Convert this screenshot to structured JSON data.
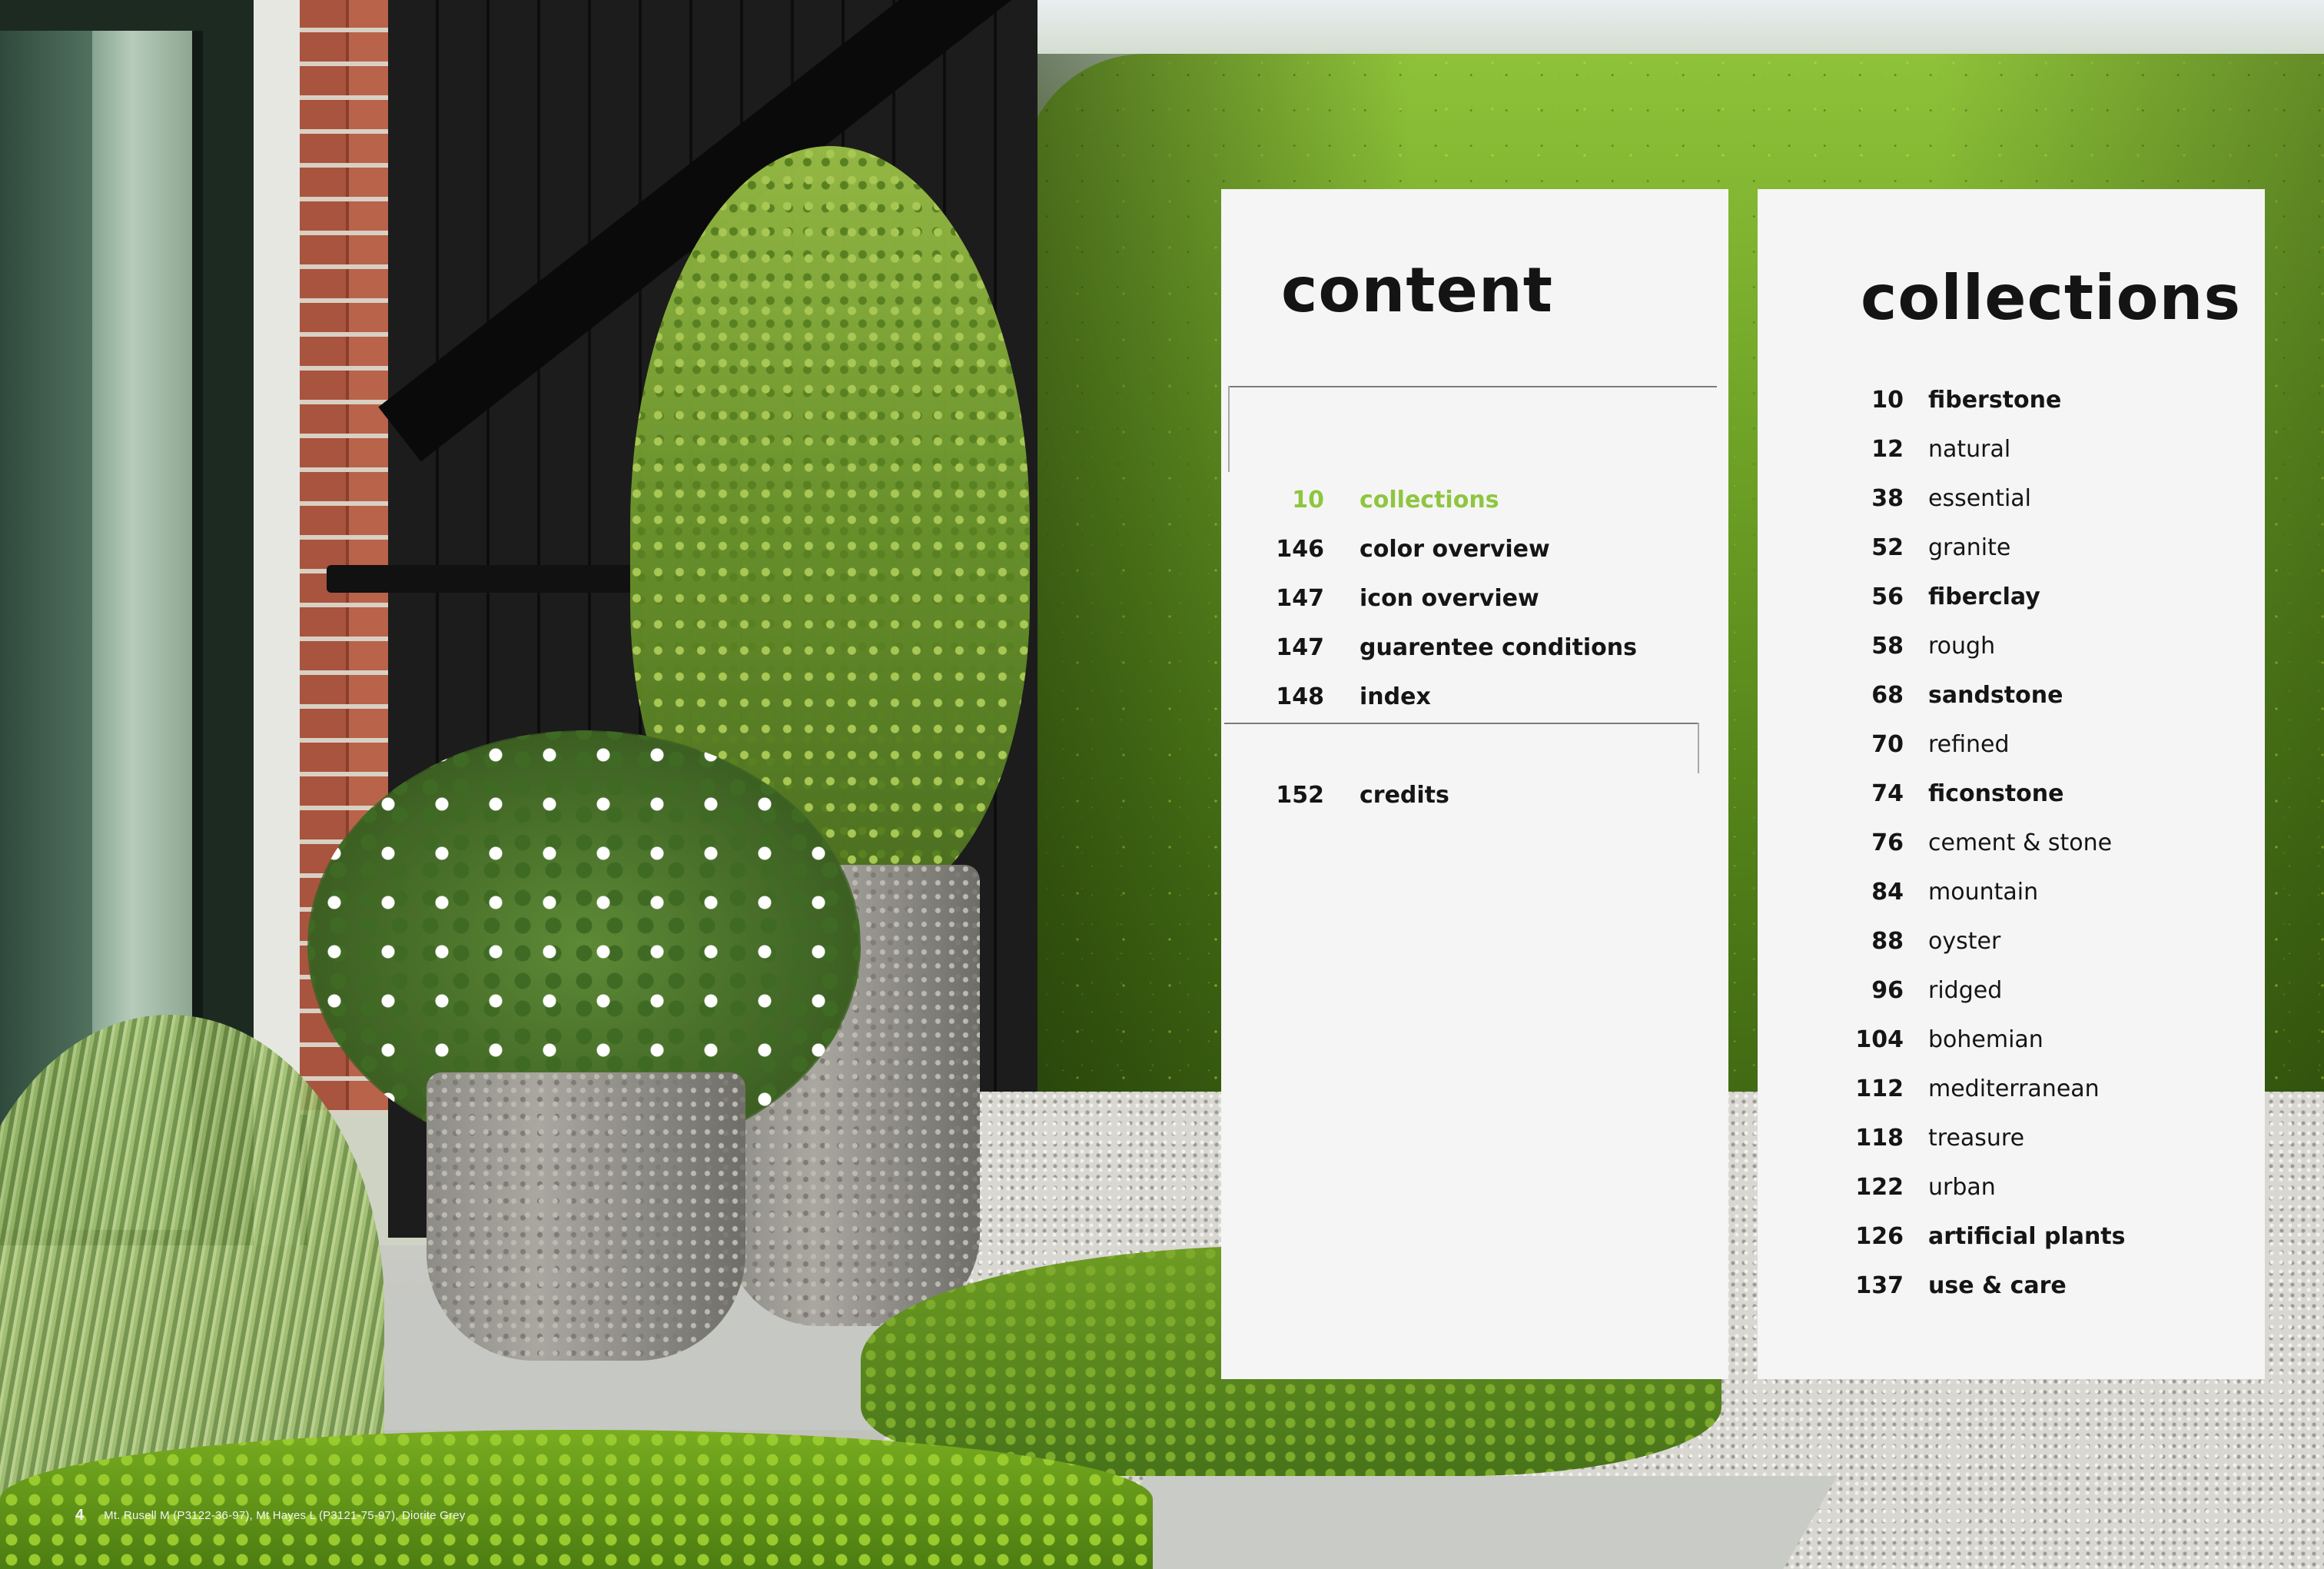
{
  "content_panel": {
    "title": "content",
    "items": [
      {
        "page": "10",
        "label": "collections",
        "highlight": true
      },
      {
        "page": "146",
        "label": "color overview",
        "highlight": false
      },
      {
        "page": "147",
        "label": "icon overview",
        "highlight": false
      },
      {
        "page": "147",
        "label": "guarentee conditions",
        "highlight": false
      },
      {
        "page": "148",
        "label": "index",
        "highlight": false
      },
      {
        "page": "152",
        "label": "credits",
        "highlight": false
      }
    ],
    "accent_color": "#8ec63f"
  },
  "collections_panel": {
    "title": "collections",
    "items": [
      {
        "page": "10",
        "label": "fiberstone",
        "bold": true
      },
      {
        "page": "12",
        "label": "natural",
        "bold": false
      },
      {
        "page": "38",
        "label": "essential",
        "bold": false
      },
      {
        "page": "52",
        "label": "granite",
        "bold": false
      },
      {
        "page": "56",
        "label": "fiberclay",
        "bold": true
      },
      {
        "page": "58",
        "label": "rough",
        "bold": false
      },
      {
        "page": "68",
        "label": "sandstone",
        "bold": true
      },
      {
        "page": "70",
        "label": "refined",
        "bold": false
      },
      {
        "page": "74",
        "label": "ficonstone",
        "bold": true
      },
      {
        "page": "76",
        "label": "cement & stone",
        "bold": false
      },
      {
        "page": "84",
        "label": "mountain",
        "bold": false
      },
      {
        "page": "88",
        "label": "oyster",
        "bold": false
      },
      {
        "page": "96",
        "label": "ridged",
        "bold": false
      },
      {
        "page": "104",
        "label": "bohemian",
        "bold": false
      },
      {
        "page": "112",
        "label": "mediterranean",
        "bold": false
      },
      {
        "page": "118",
        "label": "treasure",
        "bold": false
      },
      {
        "page": "122",
        "label": "urban",
        "bold": false
      },
      {
        "page": "126",
        "label": "artificial plants",
        "bold": true
      },
      {
        "page": "137",
        "label": "use & care",
        "bold": true
      }
    ]
  },
  "footer": {
    "page_number": "4",
    "caption": "Mt. Rusell M (P3122-36-97), Mt Hayes L (P3121-75-97), Diorite Grey"
  }
}
